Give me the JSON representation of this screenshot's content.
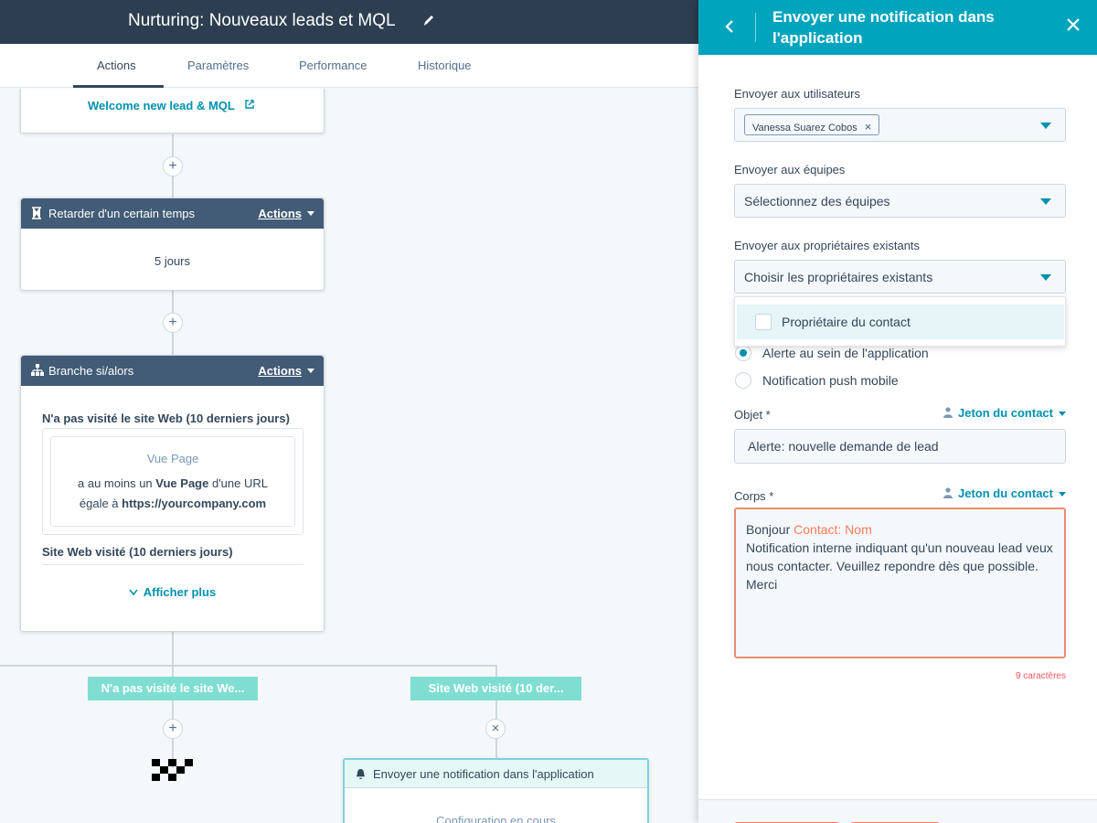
{
  "workflow": {
    "title": "Nurturing: Nouveaux leads et MQL",
    "tabs": [
      "Actions",
      "Paramètres",
      "Performance",
      "Historique"
    ]
  },
  "canvas": {
    "email_link": "Welcome new lead & MQL",
    "delay": {
      "title": "Retarder d'un certain temps",
      "actions": "Actions",
      "value": "5 jours"
    },
    "branch": {
      "title": "Branche si/alors",
      "actions": "Actions",
      "cond1_title": "N'a pas visité le site Web (10 derniers jours)",
      "filter_title": "Vue Page",
      "filter_line1_pre": "a au moins un",
      "filter_line1_bold": "Vue Page",
      "filter_line1_post": "d'une URL",
      "filter_line2_pre": "égale à",
      "filter_line2_bold": "https://yourcompany.com",
      "cond2_title": "Site Web visité (10 derniers jours)",
      "show_more": "Afficher plus"
    },
    "branch_labels": [
      "N'a pas visité le site We...",
      "Site Web visité (10 der..."
    ],
    "notif_card": {
      "title": "Envoyer une notification dans l'application",
      "status": "Configuration en cours"
    }
  },
  "panel": {
    "title": "Envoyer une notification dans l'application",
    "users_label": "Envoyer aux utilisateurs",
    "user_chip": "Vanessa Suarez Cobos",
    "teams_label": "Envoyer aux équipes",
    "teams_placeholder": "Sélectionnez des équipes",
    "owners_label": "Envoyer aux propriétaires existants",
    "owners_placeholder": "Choisir les propriétaires existants",
    "owner_option": "Propriétaire du contact",
    "radio1": "Alerte au sein de l'application",
    "radio2": "Notification push mobile",
    "object_label": "Objet *",
    "token_label": "Jeton du contact",
    "object_value": "Alerte: nouvelle demande de lead",
    "body_label": "Corps *",
    "body_greeting": "Bonjour",
    "body_token": "Contact: Nom",
    "body_text": "Notification interne indiquant qu'un nouveau lead veux nous contacter. Veuillez repondre dès que possible.",
    "body_sign": "Merci",
    "char_count": "9 caractères"
  },
  "colors": {
    "header_dark": "#2d3e50",
    "panel_accent": "#00a4bd",
    "link": "#0091ae",
    "error": "#f2545b",
    "branch": "#7fded1"
  }
}
